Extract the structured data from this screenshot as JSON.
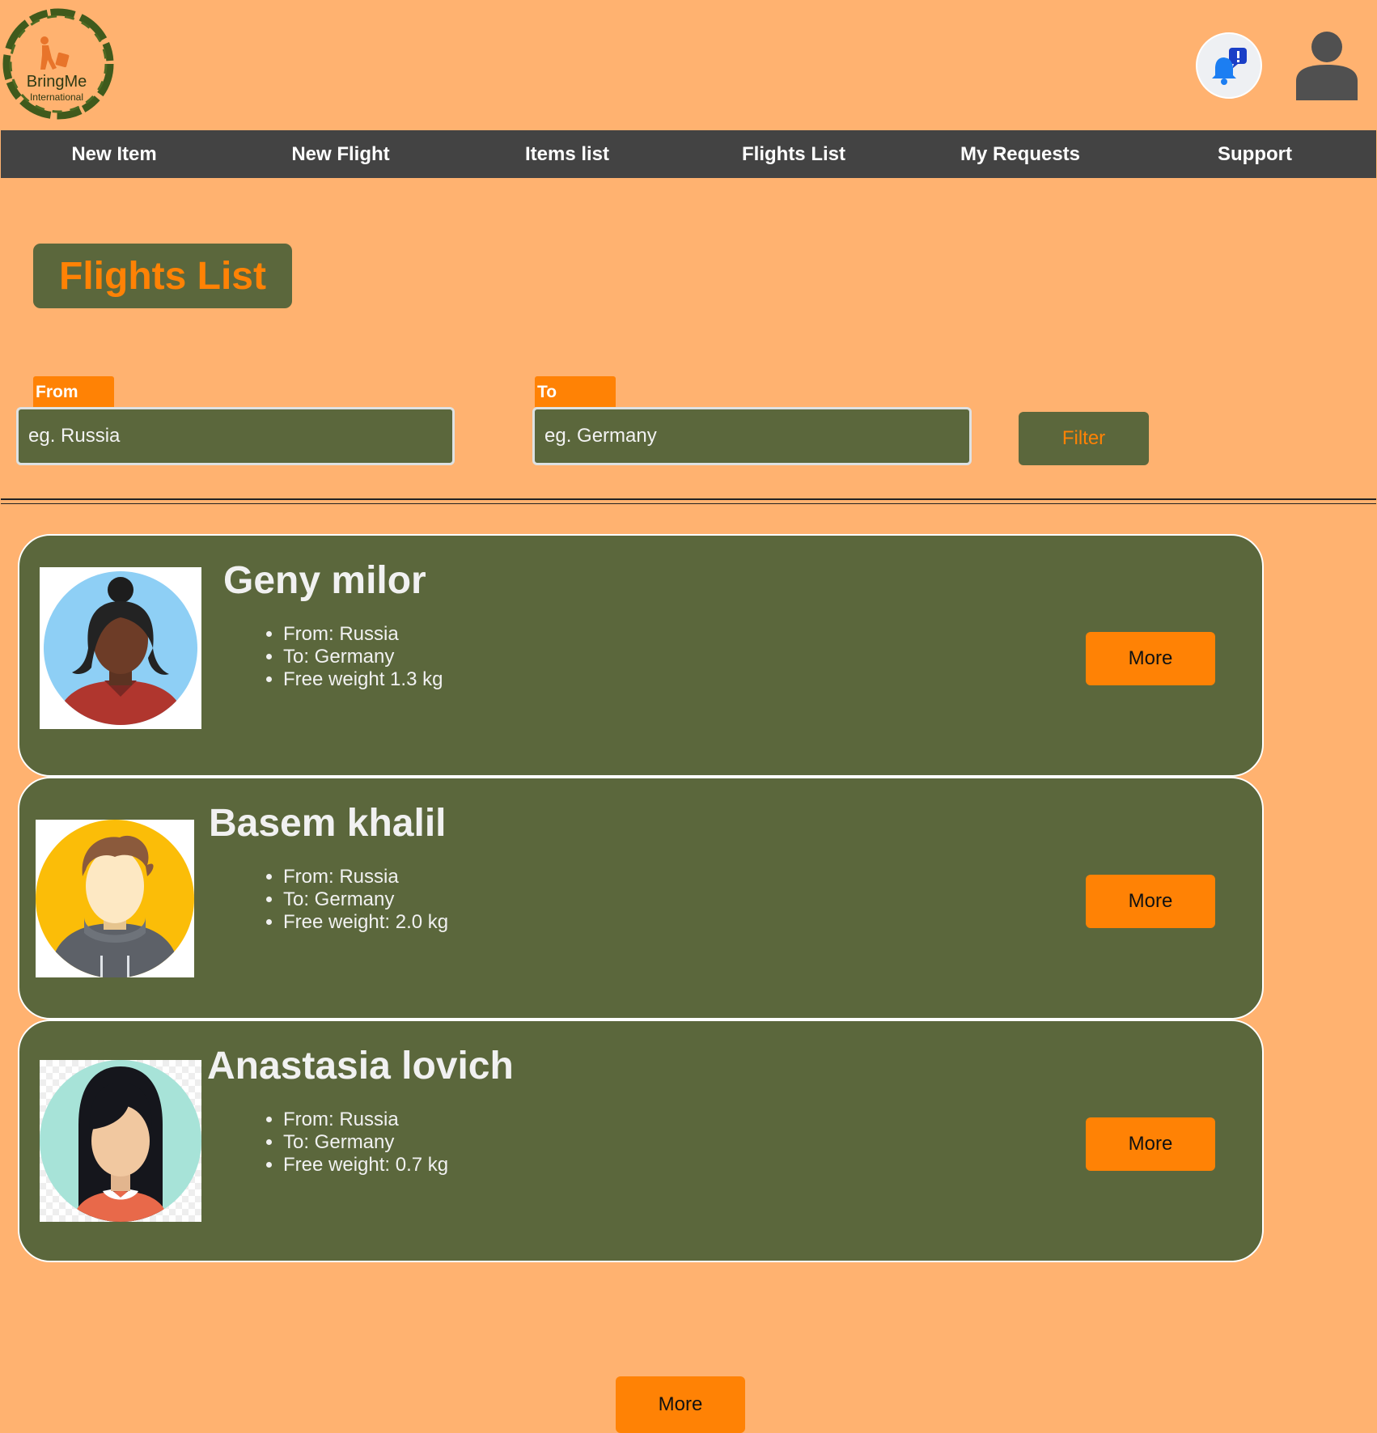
{
  "brand": {
    "name": "BringMe",
    "tagline": "International"
  },
  "nav": {
    "items": [
      {
        "label": "New Item"
      },
      {
        "label": "New Flight"
      },
      {
        "label": "Items list"
      },
      {
        "label": "Flights List"
      },
      {
        "label": "My Requests"
      },
      {
        "label": "Support"
      }
    ]
  },
  "page": {
    "title": "Flights List"
  },
  "filters": {
    "from": {
      "label": "From",
      "placeholder": "eg. Russia"
    },
    "to": {
      "label": "To",
      "placeholder": "eg. Germany"
    },
    "button_label": "Filter"
  },
  "flights": [
    {
      "name": "Geny milor",
      "from": "From: Russia",
      "to": "To: Germany",
      "weight": "Free weight 1.3 kg",
      "more_label": "More",
      "avatar": "avatar-woman-bun-icon"
    },
    {
      "name": "Basem khalil",
      "from": "From: Russia",
      "to": "To: Germany",
      "weight": "Free weight: 2.0 kg",
      "more_label": "More",
      "avatar": "avatar-man-hoodie-icon"
    },
    {
      "name": "Anastasia lovich",
      "from": "From: Russia",
      "to": "To: Germany",
      "weight": "Free weight: 0.7 kg",
      "more_label": "More",
      "avatar": "avatar-woman-long-hair-icon"
    }
  ],
  "load_more_label": "More",
  "colors": {
    "background": "#FFB270",
    "navbar": "#434343",
    "panel": "#5B673C",
    "accent": "#FF8205"
  }
}
